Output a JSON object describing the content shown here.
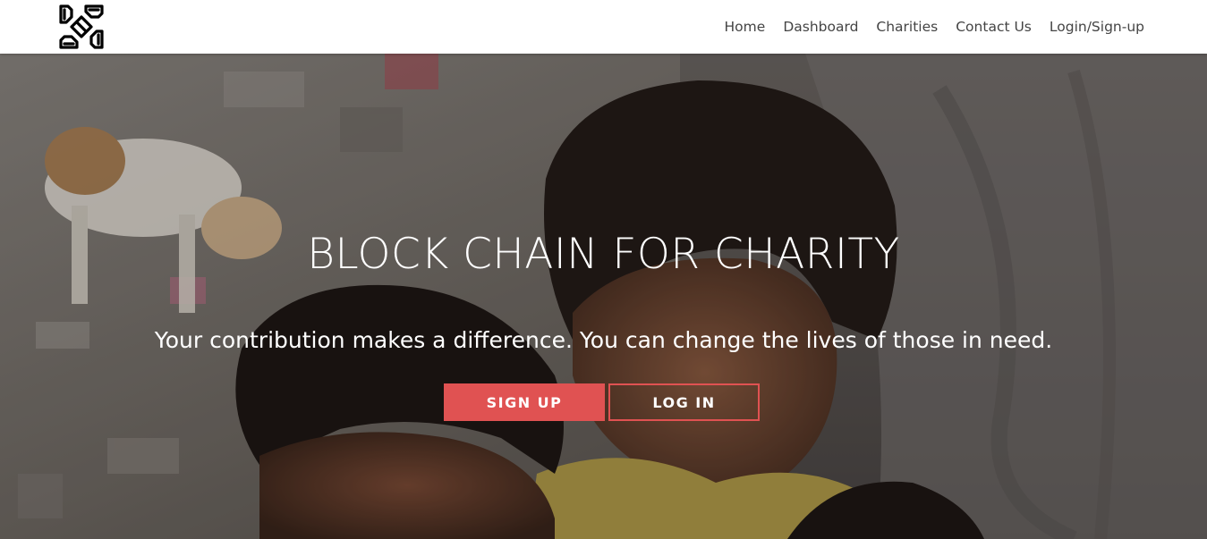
{
  "nav": {
    "logo_icon": "hands-together-logo-icon",
    "links": [
      "Home",
      "Dashboard",
      "Charities",
      "Contact Us",
      "Login/Sign-up"
    ]
  },
  "hero": {
    "title": "BLOCK CHAIN FOR CHARITY",
    "subtitle": "Your contribution makes a difference. You can change the lives of those in need.",
    "signup_label": "SIGN UP",
    "login_label": "LOG IN",
    "background_image": "photo of children in a slum with a dog"
  },
  "colors": {
    "accent": "#e05252",
    "nav_text": "#444444",
    "hero_text": "#ffffff"
  }
}
